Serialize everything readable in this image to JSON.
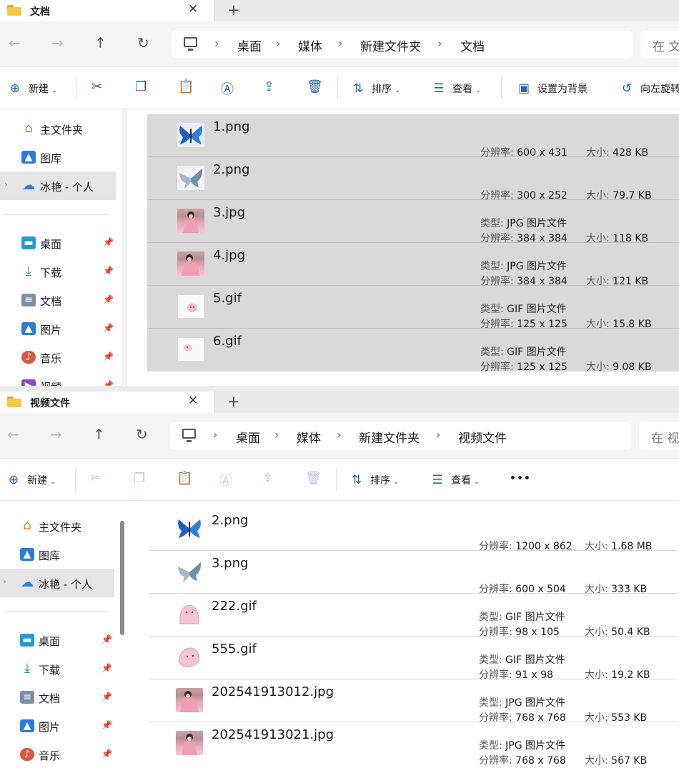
{
  "windows": [
    {
      "tab_title": "文档",
      "tab_close": "✕",
      "new_tab": "+",
      "breadcrumbs": [
        "桌面",
        "媒体",
        "新建文件夹",
        "文档"
      ],
      "search_placeholder": "在 文档 中搜索",
      "toolbar": {
        "new_label": "新建",
        "sort_label": "排序",
        "view_label": "查看",
        "set_bg_label": "设置为背景",
        "rotate_left_label": "向左旋转"
      },
      "sidebar": {
        "home": "主文件夹",
        "gallery": "图库",
        "cloud": "冰艳 - 个人",
        "desktop": "桌面",
        "downloads": "下载",
        "documents": "文档",
        "pictures": "图片",
        "music": "音乐",
        "videos": "视频"
      },
      "files": [
        {
          "name": "1.png",
          "type": "",
          "resolution": "600 x 431",
          "size": "428 KB",
          "thumb": "butterfly-blue"
        },
        {
          "name": "2.png",
          "type": "",
          "resolution": "300 x 252",
          "size": "79.7 KB",
          "thumb": "butterfly-light"
        },
        {
          "name": "3.jpg",
          "type": "JPG 图片文件",
          "resolution": "384 x 384",
          "size": "118 KB",
          "thumb": "girl-pink"
        },
        {
          "name": "4.jpg",
          "type": "JPG 图片文件",
          "resolution": "384 x 384",
          "size": "121 KB",
          "thumb": "girl-pink"
        },
        {
          "name": "5.gif",
          "type": "GIF 图片文件",
          "resolution": "125 x 125",
          "size": "15.8 KB",
          "thumb": "pink-blob"
        },
        {
          "name": "6.gif",
          "type": "GIF 图片文件",
          "resolution": "125 x 125",
          "size": "9.08 KB",
          "thumb": "pink-blob"
        }
      ]
    },
    {
      "tab_title": "视频文件",
      "tab_close": "✕",
      "new_tab": "+",
      "breadcrumbs": [
        "桌面",
        "媒体",
        "新建文件夹",
        "视频文件"
      ],
      "search_placeholder": "在 视频文件 中搜索",
      "toolbar": {
        "new_label": "新建",
        "sort_label": "排序",
        "view_label": "查看",
        "more_label": "•••"
      },
      "sidebar": {
        "home": "主文件夹",
        "gallery": "图库",
        "cloud": "冰艳 - 个人",
        "desktop": "桌面",
        "downloads": "下载",
        "documents": "文档",
        "pictures": "图片",
        "music": "音乐"
      },
      "files": [
        {
          "name": "2.png",
          "type": "",
          "resolution": "1200 x 862",
          "size": "1.68 MB",
          "thumb": "butterfly-blue"
        },
        {
          "name": "3.png",
          "type": "",
          "resolution": "600 x 504",
          "size": "333 KB",
          "thumb": "butterfly-light"
        },
        {
          "name": "222.gif",
          "type": "GIF 图片文件",
          "resolution": "98 x 105",
          "size": "50.4 KB",
          "thumb": "pink-blob"
        },
        {
          "name": "555.gif",
          "type": "GIF 图片文件",
          "resolution": "91 x 98",
          "size": "19.2 KB",
          "thumb": "pink-blob"
        },
        {
          "name": "202541913012.jpg",
          "type": "JPG 图片文件",
          "resolution": "768 x 768",
          "size": "553 KB",
          "thumb": "girl-pink"
        },
        {
          "name": "202541913021.jpg",
          "type": "JPG 图片文件",
          "resolution": "768 x 768",
          "size": "567 KB",
          "thumb": "girl-pink"
        }
      ]
    }
  ],
  "labels": {
    "type": "类型:",
    "resolution": "分辨率:",
    "size": "大小:"
  },
  "colors": {
    "accent": "#2a5fb0",
    "selection": "#d9d9d9",
    "folder": "#f6c744",
    "onedrive": "#2b7cd3"
  }
}
